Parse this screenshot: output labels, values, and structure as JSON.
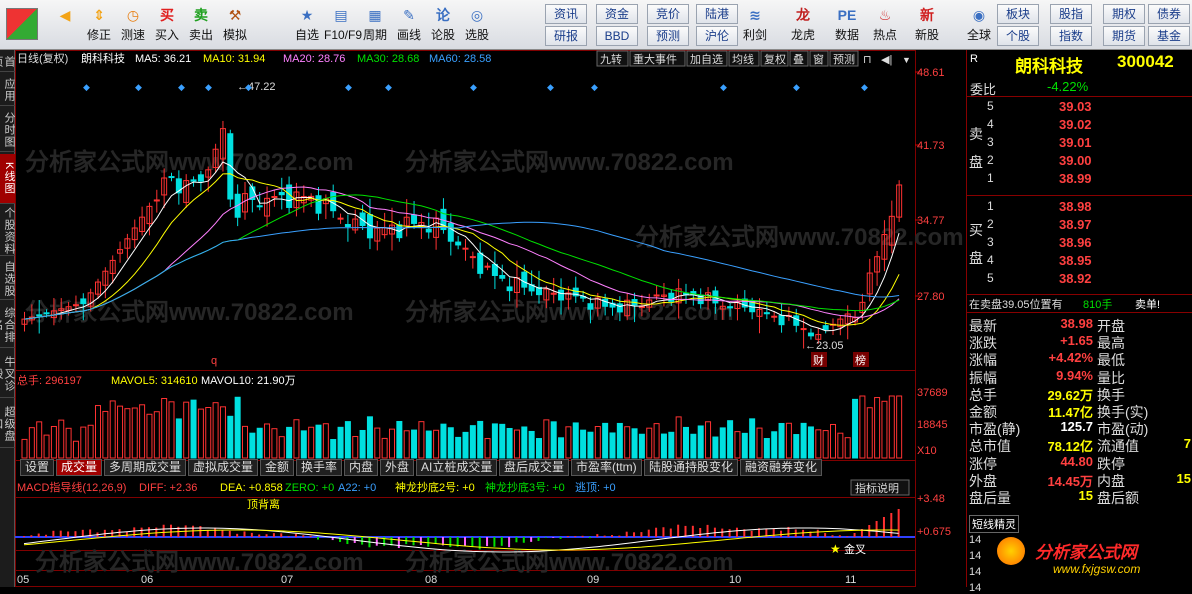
{
  "toolbar": {
    "tools": [
      {
        "label": "",
        "name": "back-button",
        "icon": "left-arrow-icon",
        "color": "#f3a316"
      },
      {
        "label": "修正",
        "name": "fix-button",
        "icon": "up-down-arrow-icon",
        "color": "#f3a316"
      },
      {
        "label": "测速",
        "name": "speed-test-button",
        "icon": "clock-icon",
        "color": "#e77e12"
      },
      {
        "label": "买入",
        "name": "buy-button",
        "icon": "buy-icon",
        "color": "#e02020"
      },
      {
        "label": "卖出",
        "name": "sell-button",
        "icon": "sell-icon",
        "color": "#20a020"
      },
      {
        "label": "模拟",
        "name": "simulate-button",
        "icon": "hammer-icon",
        "color": "#b05010"
      },
      {
        "label": "自选",
        "name": "watchlist-button",
        "icon": "star-icon",
        "color": "#3a6fc2"
      },
      {
        "label": "F10/F9",
        "name": "f10-button",
        "icon": "document-icon",
        "color": "#3a6fc2"
      },
      {
        "label": "周期",
        "name": "period-button",
        "icon": "calendar-icon",
        "color": "#3a6fc2"
      },
      {
        "label": "画线",
        "name": "draw-line-button",
        "icon": "pencil-icon",
        "color": "#3a6fc2"
      },
      {
        "label": "论股",
        "name": "discuss-button",
        "icon": "chat-icon",
        "color": "#3a6fc2"
      },
      {
        "label": "选股",
        "name": "stock-picker-button",
        "icon": "magnifier-icon",
        "color": "#3a6fc2"
      },
      {
        "label": "利剑",
        "name": "sword-button",
        "icon": "sword-chart-icon",
        "color": "#3a6fc2"
      },
      {
        "label": "龙虎",
        "name": "dragon-tiger-button",
        "icon": "dragon-icon",
        "color": "#c02020"
      },
      {
        "label": "数据",
        "name": "data-button",
        "icon": "pe-icon",
        "color": "#3a6fc2"
      },
      {
        "label": "热点",
        "name": "hotspot-button",
        "icon": "hot-icon",
        "color": "#d02020"
      },
      {
        "label": "新股",
        "name": "new-stock-button",
        "icon": "new-icon",
        "color": "#d02020"
      },
      {
        "label": "全球",
        "name": "global-button",
        "icon": "globe-icon",
        "color": "#3a6fc2"
      }
    ],
    "small_buttons": [
      "资讯",
      "资金",
      "竞价",
      "陆港",
      "研报",
      "BBD",
      "预测",
      "沪伦",
      "板块",
      "股指",
      "期权",
      "债券",
      "个股",
      "指数",
      "期货",
      "基金"
    ]
  },
  "leftbar": {
    "tabs": [
      "首页",
      "应用",
      "分时图",
      "K线图",
      "个股资料",
      "自选股",
      "综合排名",
      "牛叉诊股",
      "超级盘口"
    ],
    "active": 3
  },
  "kchart": {
    "header": {
      "period": "日线(复权)",
      "name": "朗科科技",
      "ma5": "MA5: 36.21",
      "ma10": "MA10: 31.94",
      "ma20": "MA20: 28.76",
      "ma30": "MA30: 28.68",
      "ma60": "MA60: 28.58"
    },
    "buttons": [
      "九转",
      "重大事件",
      "加自选",
      "均线",
      "复权",
      "叠",
      "窗",
      "预测"
    ],
    "price_ticks": [
      "48.61",
      "41.73",
      "34.77",
      "27.80"
    ],
    "high_label": "47.22",
    "low_label": "23.05",
    "marks": [
      "q",
      "财",
      "榜"
    ],
    "colors": {
      "up": "#ff3232",
      "down": "#00e0e0",
      "ma5": "#ffffff",
      "ma10": "#ffff00",
      "ma20": "#ff80ff",
      "ma30": "#00e000",
      "ma60": "#3aa0ff"
    }
  },
  "volume": {
    "header": {
      "total": "总手: 296197",
      "mavol5": "MAVOL5: 314610",
      "mavol10": "MAVOL10: 21.90万"
    },
    "ticks": [
      "37689",
      "18845",
      "X10"
    ]
  },
  "bottom_tabs": [
    "设置",
    "成交量",
    "多周期成交量",
    "虚拟成交量",
    "金额",
    "换手率",
    "内盘",
    "外盘",
    "AI立桩成交量",
    "盘后成交量",
    "市盈率(ttm)",
    "陆股通持股变化",
    "融资融券变化"
  ],
  "bottom_active": 1,
  "macd": {
    "header": {
      "name": "MACD指导线(12,26,9)",
      "diff": "DIFF: +2.36",
      "dea": "DEA: +0.858",
      "zero": "ZERO: +0",
      "a22": "A22: +0",
      "ssl2": "神龙抄底2号: +0",
      "ssl3": "神龙抄底3号: +0",
      "escape": "逃顶: +0"
    },
    "button": "指标说明",
    "ticks": [
      "+3.48",
      "+0.675"
    ],
    "labels": [
      "顶背离",
      "金叉"
    ]
  },
  "x_axis": [
    "05",
    "06",
    "07",
    "08",
    "09",
    "10",
    "11"
  ],
  "right_panel": {
    "stock_name": "朗科科技",
    "stock_code": "300042",
    "r_badge": "R",
    "weibi_label": "委比",
    "weibi_value": "-4.22%",
    "sell_label": "卖盘",
    "buy_label": "买盘",
    "sell": [
      {
        "level": "5",
        "price": "39.03"
      },
      {
        "level": "4",
        "price": "39.02"
      },
      {
        "level": "3",
        "price": "39.01"
      },
      {
        "level": "2",
        "price": "39.00"
      },
      {
        "level": "1",
        "price": "38.99"
      }
    ],
    "buy": [
      {
        "level": "1",
        "price": "38.98"
      },
      {
        "level": "2",
        "price": "38.97"
      },
      {
        "level": "3",
        "price": "38.96"
      },
      {
        "level": "4",
        "price": "38.95"
      },
      {
        "level": "5",
        "price": "38.92"
      }
    ],
    "order_text": "在卖盘39.05位置有",
    "order_vol": "810手",
    "order_tag": "卖单!",
    "stats": [
      [
        "最新",
        "38.98",
        "开盘",
        ""
      ],
      [
        "涨跌",
        "+1.65",
        "最高",
        ""
      ],
      [
        "涨幅",
        "+4.42%",
        "最低",
        ""
      ],
      [
        "振幅",
        "9.94%",
        "量比",
        ""
      ],
      [
        "总手",
        "29.62万",
        "换手",
        ""
      ],
      [
        "金额",
        "11.47亿",
        "换手(实)",
        ""
      ],
      [
        "市盈(静)",
        "125.7",
        "市盈(动)",
        ""
      ],
      [
        "总市值",
        "78.12亿",
        "流通值",
        "7"
      ],
      [
        "涨停",
        "44.80",
        "跌停",
        ""
      ],
      [
        "外盘",
        "14.45万",
        "内盘",
        "15"
      ],
      [
        "盘后量",
        "15",
        "盘后额",
        ""
      ]
    ],
    "duanxian": "短线精灵",
    "duanxian_rows": [
      "14",
      "14",
      "14",
      "14"
    ],
    "watermark": "分析家公式网",
    "watermark_url": "www.fxjgsw.com"
  },
  "watermark": "分析家公式网www.70822.com"
}
